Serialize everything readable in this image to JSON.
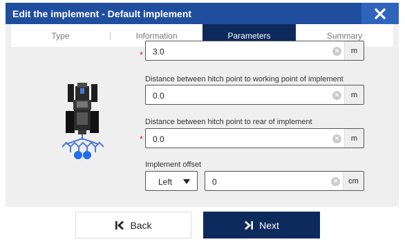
{
  "dialog": {
    "title": "Edit the implement - Default implement",
    "close_icon": "close-icon"
  },
  "tabs": [
    {
      "label": "Type",
      "active": false
    },
    {
      "label": "Information",
      "active": false
    },
    {
      "label": "Parameters",
      "active": true
    },
    {
      "label": "Summary",
      "active": false
    }
  ],
  "fields": {
    "top_field": {
      "value": "3.0",
      "unit": "m",
      "required": true
    },
    "hitch_to_working": {
      "label": "Distance between hitch point to working point of implement",
      "value": "0.0",
      "unit": "m",
      "required": false
    },
    "hitch_to_rear": {
      "label": "Distance between hitch point to rear of implement",
      "value": "0.0",
      "unit": "m",
      "required": true
    },
    "implement_offset": {
      "label": "Implement offset",
      "direction": "Left",
      "value": "0",
      "unit": "cm",
      "required": false
    }
  },
  "required_marker": "*",
  "clear_glyph": "×",
  "buttons": {
    "back": {
      "label": "Back",
      "icon": "back-arrow-icon"
    },
    "next": {
      "label": "Next",
      "icon": "next-arrow-icon"
    }
  },
  "colors": {
    "titlebar": "#1f4e9e",
    "accent_dark": "#0d2a5c",
    "required": "#e02020",
    "implement": "#4a78d8"
  },
  "illustration": "tractor-with-implement-icon"
}
